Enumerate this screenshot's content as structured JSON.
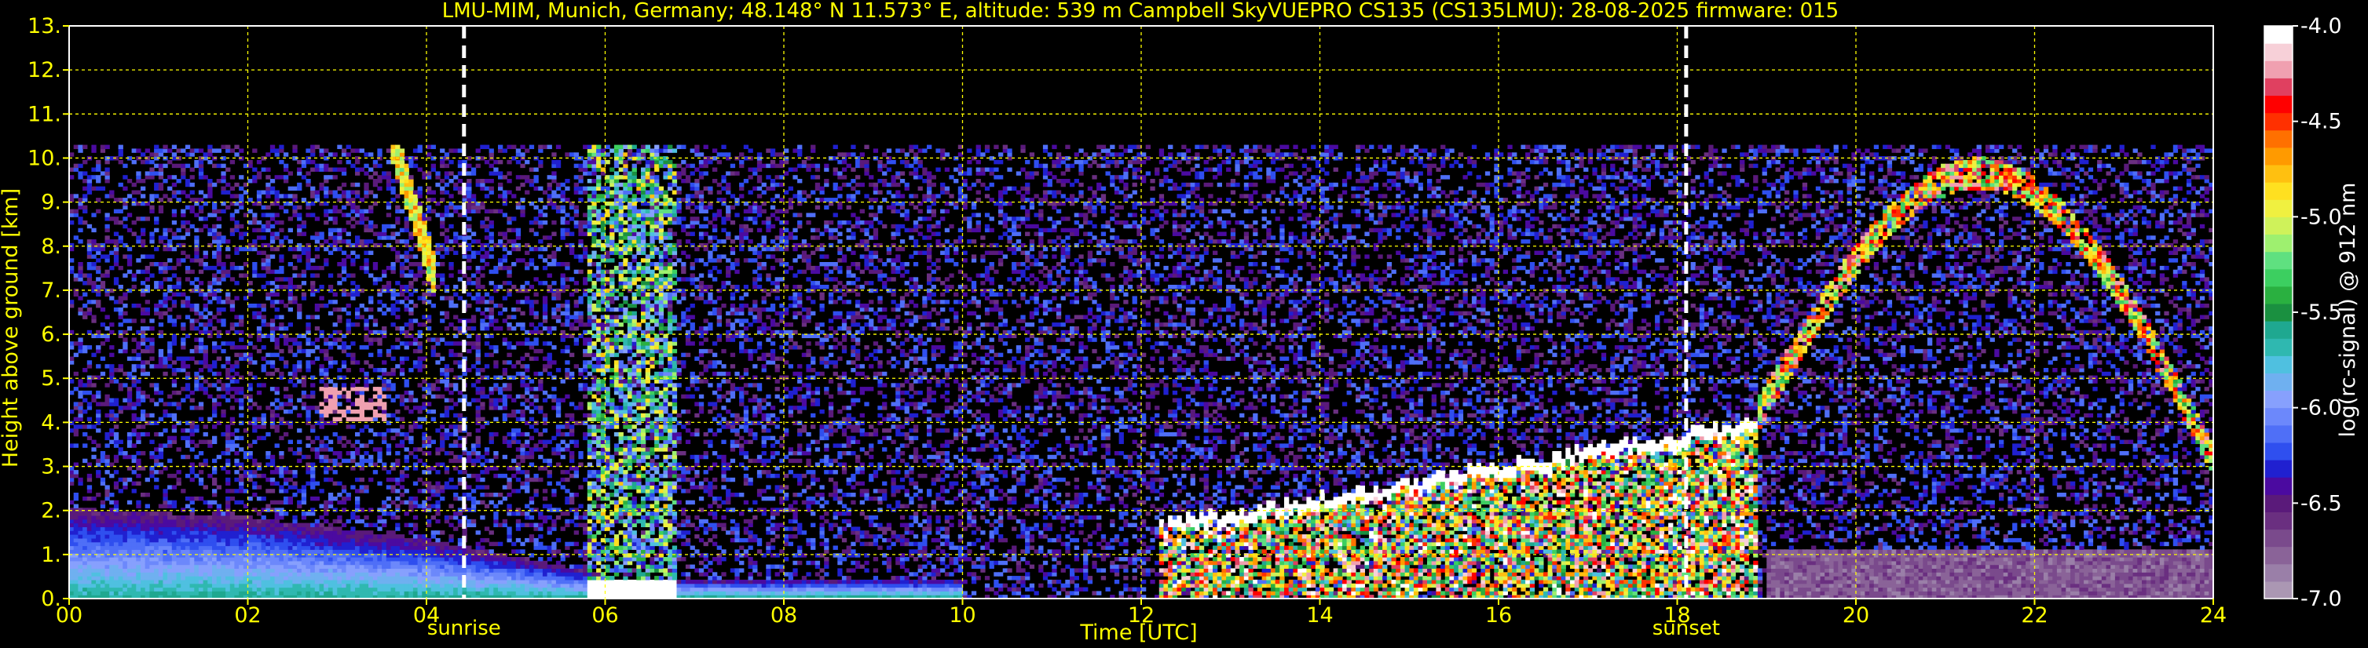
{
  "title": "LMU-MIM, Munich, Germany; 48.148° N 11.573° E, altitude: 539 m    Campbell SkyVUEPRO CS135 (CS135LMU): 28-08-2025    firmware: 015",
  "colors": {
    "background": "#000000",
    "text": "#ffff00",
    "grid": "#ffff00",
    "colorbar_text": "#ffffff"
  },
  "chart_data": {
    "type": "heatmap",
    "xlabel": "Time [UTC]",
    "ylabel": "Height above ground [km]",
    "xlim": [
      0,
      24
    ],
    "ylim": [
      0,
      13
    ],
    "x_ticks": [
      "00",
      "02",
      "04",
      "06",
      "08",
      "10",
      "12",
      "14",
      "16",
      "18",
      "20",
      "22",
      "24"
    ],
    "y_ticks": [
      "0.",
      "1.",
      "2.",
      "3.",
      "4.",
      "5.",
      "6.",
      "7.",
      "8.",
      "9.",
      "10.",
      "11.",
      "12.",
      "13."
    ],
    "grid": true,
    "markers": [
      {
        "label": "sunrise",
        "x": 4.42
      },
      {
        "label": "sunset",
        "x": 18.1
      }
    ],
    "colorbar": {
      "label": "log(rc-signal) @ 912 nm",
      "range": [
        -7.0,
        -4.0
      ],
      "ticks": [
        "-4.0",
        "-4.5",
        "-5.0",
        "-5.5",
        "-6.0",
        "-6.5",
        "-7.0"
      ],
      "colors": [
        "#ab97b3",
        "#9a7fa8",
        "#8a6398",
        "#7a4a8c",
        "#6a2f80",
        "#5a1a7a",
        "#4b0aa0",
        "#2020d0",
        "#2f4fef",
        "#4f6ff7",
        "#6c88fb",
        "#87a0fd",
        "#6fb0f0",
        "#4fc0e0",
        "#2fb8b0",
        "#1fa890",
        "#1a9040",
        "#2ab040",
        "#3ccf60",
        "#5fe080",
        "#9ef06f",
        "#cff25a",
        "#f0f040",
        "#ffe020",
        "#ffc010",
        "#ff9a00",
        "#ff7000",
        "#ff3000",
        "#ff0000",
        "#e04060",
        "#f0a0b0",
        "#f7d0d8",
        "#ffffff"
      ]
    },
    "field": {
      "profile_top_km": 10.3,
      "features": [
        {
          "kind": "boundary_layer",
          "x": [
            0,
            6
          ],
          "y_top": [
            2.0,
            1.5,
            1.1,
            0.5
          ],
          "intensity": [
            -6.5,
            -6.0
          ]
        },
        {
          "kind": "noise_background",
          "x": [
            0,
            24
          ],
          "y": [
            0,
            10.3
          ],
          "intensity": [
            -6.6,
            -6.0
          ]
        },
        {
          "kind": "cirrus",
          "x": [
            3.7,
            4.1
          ],
          "y": [
            7.0,
            10.3
          ],
          "intensity": -5.0
        },
        {
          "kind": "precipitation",
          "x": [
            5.8,
            6.8
          ],
          "y": [
            0.3,
            10.3
          ],
          "intensity": -5.5
        },
        {
          "kind": "elevated_layer",
          "x": [
            2.8,
            3.5
          ],
          "y": [
            4.0,
            4.8
          ],
          "intensity": -4.0
        },
        {
          "kind": "cumulus_clouds",
          "x": [
            12.2,
            18.9
          ],
          "y": [
            0.1,
            3.9
          ],
          "intensity": [
            -4.0,
            -5.5
          ]
        },
        {
          "kind": "cirrus_arc",
          "x": [
            18.9,
            24
          ],
          "y": [
            3.0,
            10.3
          ],
          "intensity": [
            -4.5,
            -5.5
          ]
        },
        {
          "kind": "night_boundary_layer",
          "x": [
            19,
            24
          ],
          "y": [
            0,
            1.1
          ],
          "intensity": -6.8
        }
      ]
    }
  }
}
